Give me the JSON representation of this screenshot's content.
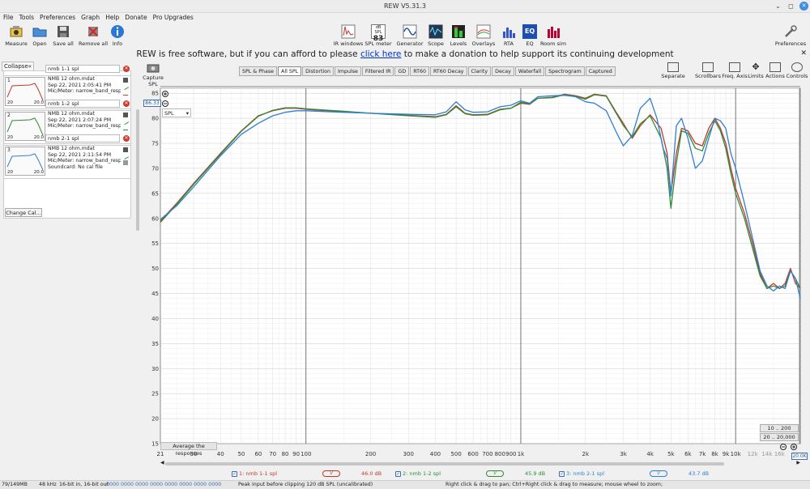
{
  "window": {
    "title": "REW V5.31.3"
  },
  "menu": [
    "File",
    "Tools",
    "Preferences",
    "Graph",
    "Help",
    "Donate",
    "Pro Upgrades"
  ],
  "toolbar": {
    "left": [
      "Measure",
      "Open",
      "Save all",
      "Remove all",
      "Info"
    ],
    "center": [
      "IR windows",
      "SPL meter",
      "Generator",
      "Scope",
      "Levels",
      "Overlays",
      "RTA",
      "EQ",
      "Room sim"
    ],
    "spl_meter_badge_top": "dB SPL",
    "spl_meter_badge_value": "83",
    "preferences": "Preferences"
  },
  "banner": {
    "text_before": "REW is free software, but if you can afford to please ",
    "link": "click here",
    "text_after": " to make a donation to help support its continuing development"
  },
  "left_panel": {
    "collapse_label": "Collapse",
    "change_cal_label": "Change Cal...",
    "measurements": [
      {
        "index": "1",
        "name": "nmb 1-1 spl",
        "file": "NMB 12 ohm.mdat",
        "date": "Sep 22, 2021 2:05:41 PM",
        "mic": "Mic/Meter: narrow_band_respo",
        "color": "#c0392b"
      },
      {
        "index": "2",
        "name": "nmb 1-2 spl",
        "file": "NMB 12 ohm.mdat",
        "date": "Sep 22, 2021 2:07:24 PM",
        "mic": "Mic/Meter: narrow_band_respo",
        "color": "#2e8b3a"
      },
      {
        "index": "3",
        "name": "nmb 2-1 spl",
        "file": "NMB 12 ohm.mdat",
        "date": "Sep 22, 2021 2:11:54 PM",
        "mic": "Mic/Meter: narrow_band_respo",
        "soundcard": "Soundcard: No cal file",
        "color": "#2f7fd0"
      }
    ],
    "thumb_low": "20",
    "thumb_high": "20.0"
  },
  "graph": {
    "capture_label": "Capture",
    "capture_sublabel": "SPL",
    "tabs": [
      "SPL & Phase",
      "All SPL",
      "Distortion",
      "Impulse",
      "Filtered IR",
      "GD",
      "RT60",
      "RT60 Decay",
      "Clarity",
      "Decay",
      "Waterfall",
      "Spectrogram",
      "Captured"
    ],
    "active_tab": "All SPL",
    "right_tools": [
      "Separate",
      "Scrollbars",
      "Freq. Axis",
      "Limits",
      "Actions",
      "Controls"
    ],
    "spl_select": "SPL",
    "spl_readout": "86.33",
    "freq_readout": "20.0K",
    "average_label": "Average the responses",
    "range_buttons": [
      "10 .. 200",
      "20 .. 20,000"
    ]
  },
  "chart_data": {
    "type": "line",
    "xlabel": "",
    "ylabel": "",
    "xscale": "log",
    "xlim": [
      21,
      20000
    ],
    "ylim": [
      15,
      86
    ],
    "y_ticks": [
      85,
      80,
      75,
      70,
      65,
      60,
      55,
      50,
      45,
      40,
      35,
      30,
      25,
      20,
      15
    ],
    "x_ticks": [
      {
        "v": 21,
        "label": "21"
      },
      {
        "v": 30,
        "label": "30"
      },
      {
        "v": 40,
        "label": "40"
      },
      {
        "v": 50,
        "label": "50"
      },
      {
        "v": 60,
        "label": "60"
      },
      {
        "v": 70,
        "label": "70"
      },
      {
        "v": 80,
        "label": "80"
      },
      {
        "v": 90,
        "label": "90"
      },
      {
        "v": 100,
        "label": "100"
      },
      {
        "v": 200,
        "label": "200"
      },
      {
        "v": 300,
        "label": "300"
      },
      {
        "v": 400,
        "label": "400"
      },
      {
        "v": 500,
        "label": "500"
      },
      {
        "v": 600,
        "label": "600"
      },
      {
        "v": 700,
        "label": "700"
      },
      {
        "v": 800,
        "label": "800"
      },
      {
        "v": 900,
        "label": "900"
      },
      {
        "v": 1000,
        "label": "1k"
      },
      {
        "v": 2000,
        "label": "2k"
      },
      {
        "v": 3000,
        "label": "3k"
      },
      {
        "v": 4000,
        "label": "4k"
      },
      {
        "v": 5000,
        "label": "5k"
      },
      {
        "v": 6000,
        "label": "6k"
      },
      {
        "v": 7000,
        "label": "7k"
      },
      {
        "v": 8000,
        "label": "8k"
      },
      {
        "v": 9000,
        "label": "9k"
      },
      {
        "v": 10000,
        "label": "10k"
      },
      {
        "v": 12000,
        "label": "12k"
      },
      {
        "v": 14000,
        "label": "14k"
      },
      {
        "v": 16000,
        "label": "16k"
      }
    ],
    "series": [
      {
        "name": "nmb 1-1 spl",
        "color": "#c0392b",
        "x": [
          21,
          25,
          30,
          40,
          50,
          60,
          70,
          80,
          90,
          100,
          150,
          200,
          300,
          400,
          450,
          500,
          550,
          600,
          700,
          800,
          900,
          1000,
          1100,
          1200,
          1400,
          1600,
          1800,
          2000,
          2200,
          2500,
          2800,
          3000,
          3300,
          3600,
          4000,
          4500,
          4800,
          5000,
          5300,
          5600,
          6000,
          6500,
          7000,
          7500,
          8000,
          8500,
          9000,
          9500,
          10000,
          11000,
          12000,
          13000,
          14000,
          15000,
          16000,
          17000,
          18000,
          19000,
          20000
        ],
        "y": [
          59.5,
          63,
          67,
          73,
          77.5,
          80.5,
          81.5,
          82,
          82,
          81.8,
          81.3,
          81,
          80.6,
          80.3,
          80.8,
          82.5,
          81,
          80.7,
          80.8,
          81.8,
          82,
          83,
          82.8,
          84,
          84.2,
          84.8,
          84.5,
          84,
          84.8,
          84.5,
          81,
          79,
          76,
          78.5,
          80.7,
          78,
          73,
          65,
          73,
          78,
          77.5,
          75,
          74.5,
          78,
          80,
          78,
          75,
          70,
          66,
          61,
          55,
          49,
          46,
          47,
          46,
          47,
          50,
          47,
          46
        ]
      },
      {
        "name": "nmb 1-2 spl",
        "color": "#2e8b3a",
        "x": [
          21,
          25,
          30,
          40,
          50,
          60,
          70,
          80,
          90,
          100,
          150,
          200,
          300,
          400,
          450,
          500,
          550,
          600,
          700,
          800,
          900,
          1000,
          1100,
          1200,
          1400,
          1600,
          1800,
          2000,
          2200,
          2500,
          2800,
          3000,
          3300,
          3600,
          4000,
          4500,
          4800,
          5000,
          5300,
          5600,
          6000,
          6500,
          7000,
          7500,
          8000,
          8500,
          9000,
          9500,
          10000,
          11000,
          12000,
          13000,
          14000,
          15000,
          16000,
          17000,
          18000,
          19000,
          20000
        ],
        "y": [
          59.2,
          62.8,
          66.8,
          72.8,
          77.4,
          80.4,
          81.6,
          82.1,
          82.1,
          81.9,
          81.4,
          81,
          80.5,
          80.2,
          80.7,
          82.3,
          80.9,
          80.6,
          80.7,
          81.7,
          82,
          83.2,
          82.9,
          84,
          84.1,
          84.7,
          84.4,
          83.8,
          84.7,
          84.4,
          80.8,
          78.6,
          76.3,
          78.9,
          80.5,
          76,
          70,
          62,
          71,
          77.5,
          77,
          74,
          73.5,
          77,
          79.5,
          77.5,
          74,
          69,
          65,
          60,
          54,
          48.5,
          46,
          46.5,
          46,
          46.5,
          49.5,
          48,
          46
        ]
      },
      {
        "name": "nmb 2-1 spl",
        "color": "#2f7fd0",
        "x": [
          21,
          25,
          30,
          40,
          50,
          60,
          70,
          80,
          90,
          100,
          150,
          200,
          300,
          400,
          450,
          500,
          550,
          600,
          700,
          800,
          900,
          1000,
          1100,
          1200,
          1400,
          1600,
          1800,
          2000,
          2200,
          2500,
          2800,
          3000,
          3300,
          3600,
          4000,
          4300,
          4600,
          4800,
          5000,
          5300,
          5600,
          6000,
          6500,
          7000,
          7500,
          8000,
          8500,
          9000,
          9500,
          10000,
          11000,
          12000,
          13000,
          14000,
          15000,
          16000,
          17000,
          18000,
          19000,
          20000
        ],
        "y": [
          59.8,
          62.5,
          66.3,
          72.5,
          76.8,
          79,
          80.5,
          81.2,
          81.5,
          81.5,
          81.2,
          81,
          80.8,
          80.7,
          81.3,
          83.3,
          81.7,
          81.2,
          81.3,
          82.3,
          82.6,
          83.5,
          83,
          84.3,
          84.5,
          84.6,
          84.3,
          83.3,
          83,
          81.5,
          77,
          74.5,
          76.5,
          82,
          84,
          80,
          74,
          72,
          64.5,
          78.5,
          80,
          76,
          70,
          71.5,
          76,
          80,
          79.5,
          78,
          73,
          70,
          63,
          56,
          49.5,
          46.5,
          45.5,
          46.5,
          46,
          49.5,
          48,
          44
        ]
      }
    ]
  },
  "legend": {
    "items": [
      {
        "label": "1: nmb 1-1 spl",
        "value": "46.0 dB",
        "color": "#c0392b",
        "badge": "V"
      },
      {
        "label": "2: nmb 1-2 spl",
        "value": "45.9 dB",
        "color": "#2e8b3a",
        "badge": "V"
      },
      {
        "label": "3: nmb 2-1 spl",
        "value": "43.7 dB",
        "color": "#2f7fd0",
        "badge": "V"
      }
    ]
  },
  "statusbar": {
    "memory": "79/149MB",
    "rate": "48 kHz",
    "bits": "16-bit in, 16-bit out",
    "hex": "0000 0000 0000 0000 0000 0000 0000 0000",
    "peak": "Peak input before clipping 120 dB SPL (uncalibrated)",
    "hint": "Right click & drag to pan; Ctrl+Right click & drag to measure; mouse wheel to zoom;"
  }
}
